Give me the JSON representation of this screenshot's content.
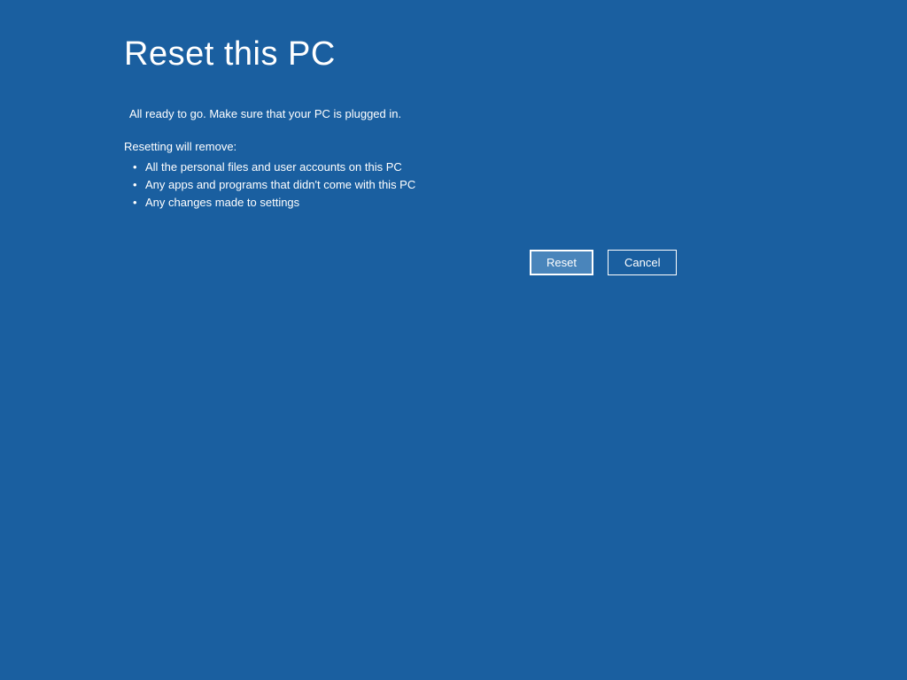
{
  "title": "Reset this PC",
  "status": "All ready to go. Make sure that your PC is plugged in.",
  "removal_intro": "Resetting will remove:",
  "removal_items": [
    "All the personal files and user accounts on this PC",
    "Any apps and programs that didn't come with this PC",
    "Any changes made to settings"
  ],
  "buttons": {
    "reset": "Reset",
    "cancel": "Cancel"
  }
}
